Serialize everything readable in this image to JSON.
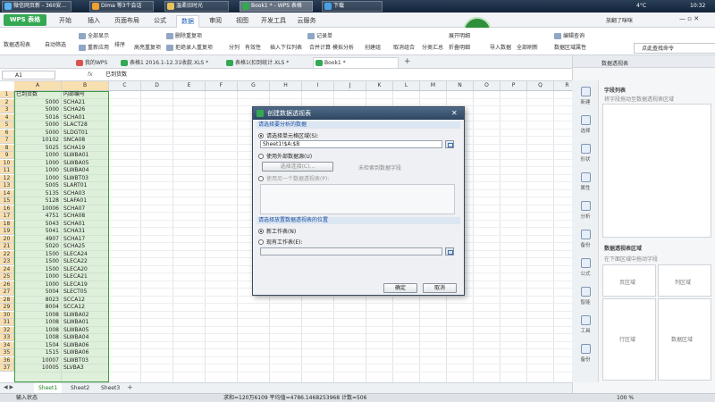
{
  "taskbar": {
    "buttons": [
      "微信网页新 - 360安...",
      "Dima 等3个会话",
      "温柔旧时光",
      "Book1 * - WPS 表格",
      "下载"
    ],
    "time": "10:32",
    "temp": "4°C"
  },
  "ribbon": {
    "app_name": "WPS 表格",
    "tabs": [
      "开始",
      "插入",
      "页面布局",
      "公式",
      "数据",
      "审阅",
      "视图",
      "开发工具",
      "云服务"
    ],
    "active_tab": "数据",
    "user": "放翻了咪咪",
    "buttons": [
      "数据透视表",
      "自动筛选",
      "全部显示",
      "重新应用",
      "排序",
      "高亮重复项",
      "删除重复项",
      "拒绝录入重复项",
      "分列",
      "有效性",
      "插入下拉列表",
      "合并计算",
      "模拟分析",
      "记录单",
      "创建组",
      "取消组合",
      "分类汇总",
      "展开明细",
      "折叠明细",
      "导入数据",
      "全部刷新",
      "数据区域属性",
      "编辑查询"
    ]
  },
  "doc_tabs": [
    "我的WPS",
    "表格1 2016.1-12.31收款.XLS *",
    "表格1(扣到统计.XLS *",
    "Book1 *"
  ],
  "formula_bar": {
    "name_box": "A1",
    "fx": "fx",
    "content": "已到货数"
  },
  "grid": {
    "columns": [
      "A",
      "B",
      "C",
      "D",
      "E",
      "F",
      "G",
      "H",
      "I",
      "J",
      "K",
      "L",
      "M",
      "N",
      "O",
      "P",
      "Q",
      "R"
    ],
    "selected_columns": [
      "A",
      "B"
    ],
    "rows": [
      [
        "已到货数",
        "内部编号"
      ],
      [
        "5000",
        "SCHA21"
      ],
      [
        "5000",
        "SCHA26"
      ],
      [
        "5016",
        "SCHA01"
      ],
      [
        "5000",
        "SLACT28"
      ],
      [
        "5000",
        "SLDGT01"
      ],
      [
        "10102",
        "SNCA08"
      ],
      [
        "5025",
        "SCHA19"
      ],
      [
        "1000",
        "SLWBA01"
      ],
      [
        "1000",
        "SLWBA05"
      ],
      [
        "1000",
        "SLWBA04"
      ],
      [
        "1000",
        "SLWBT03"
      ],
      [
        "5005",
        "SLART01"
      ],
      [
        "5135",
        "SCHA03"
      ],
      [
        "5128",
        "SLAFA01"
      ],
      [
        "10006",
        "SCHA07"
      ],
      [
        "4751",
        "SCHA08"
      ],
      [
        "5043",
        "SCHA01"
      ],
      [
        "5041",
        "SCHA31"
      ],
      [
        "4907",
        "SCHA17"
      ],
      [
        "5020",
        "SCHA25"
      ],
      [
        "1500",
        "SLECA24"
      ],
      [
        "1500",
        "SLECA22"
      ],
      [
        "1500",
        "SLECA20"
      ],
      [
        "1000",
        "SLECA21"
      ],
      [
        "1000",
        "SLECA19"
      ],
      [
        "5004",
        "SLECT05"
      ],
      [
        "8023",
        "SCCA12"
      ],
      [
        "8004",
        "SCCA12"
      ],
      [
        "1008",
        "SLWBA02"
      ],
      [
        "1008",
        "SLWBA01"
      ],
      [
        "1008",
        "SLWBA05"
      ],
      [
        "1008",
        "SLWBA04"
      ],
      [
        "1504",
        "SLWBA06"
      ],
      [
        "1515",
        "SLWBA06"
      ],
      [
        "10007",
        "SLWBT03"
      ],
      [
        "10005",
        "SLVBA3"
      ]
    ]
  },
  "sheets": [
    "Sheet1",
    "Sheet2",
    "Sheet3"
  ],
  "active_sheet": "Sheet1",
  "statusbar": {
    "left": "输入状态",
    "stats": "求和=120万6109 平均值=4786.1468253968 计数=506",
    "zoom": "100 %"
  },
  "taskpane": {
    "title": "数据透视表",
    "field_list": "字段列表",
    "field_hint": "将字段拖动至数据透视表区域",
    "areas_title": "数据透视表区域",
    "areas_hint": "在下面区域中拖动字段",
    "page_area": "页区域",
    "col_area": "列区域",
    "row_area": "行区域",
    "data_area": "数据区域",
    "side_items": [
      "新建",
      "选择",
      "形状",
      "属性",
      "分析",
      "备份",
      "公式",
      "智能",
      "工具",
      "备份"
    ]
  },
  "dialog": {
    "title": "创建数据透视表",
    "section1": "请选择要分析的数据",
    "opt1": "请选择单元格区域(S):",
    "range_value": "Sheet1!$A:$B",
    "opt2": "使用外部数据源(U)",
    "choose_conn": "选择连接(C)...",
    "no_fields": "未检索到数据字段",
    "opt3": "使用另一个数据透视表(P):",
    "section2": "请选择放置数据透视表的位置",
    "opt4": "新工作表(N)",
    "opt5": "现有工作表(E):",
    "ok": "确定",
    "cancel": "取消"
  },
  "colors": {
    "accent": "#34a853",
    "selection": "#3f9d3f",
    "title_bar": "#2e4661"
  }
}
